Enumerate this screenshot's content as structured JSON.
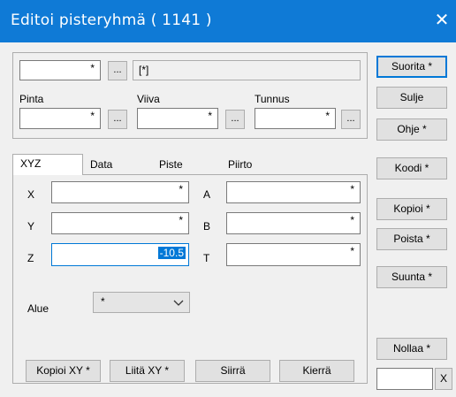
{
  "window": {
    "title": "Editoi pisteryhmä  ( 1141 )",
    "close_glyph": "✕"
  },
  "top": {
    "code_field": "*",
    "dots": "...",
    "description": "[*]",
    "pinta_label": "Pinta",
    "pinta_value": "*",
    "viiva_label": "Viiva",
    "viiva_value": "*",
    "tunnus_label": "Tunnus",
    "tunnus_value": "*"
  },
  "tabs": [
    {
      "label": "XYZ",
      "active": true
    },
    {
      "label": "Data"
    },
    {
      "label": "Piste"
    },
    {
      "label": "Piirto"
    }
  ],
  "xyz": {
    "x_label": "X",
    "x_value": "*",
    "y_label": "Y",
    "y_value": "*",
    "z_label": "Z",
    "z_value": "-10.5",
    "a_label": "A",
    "a_value": "*",
    "b_label": "B",
    "b_value": "*",
    "t_label": "T",
    "t_value": "*",
    "alue_label": "Alue",
    "alue_value": "*"
  },
  "bottom_buttons": {
    "kopioi_xy": "Kopioi XY *",
    "liita_xy": "Liitä XY *",
    "siirra": "Siirrä",
    "kierra": "Kierrä"
  },
  "side_buttons": {
    "suorita": "Suorita *",
    "sulje": "Sulje",
    "ohje": "Ohje *",
    "koodi": "Koodi *",
    "kopioi": "Kopioi *",
    "poista": "Poista *",
    "suunta": "Suunta *",
    "nollaa": "Nollaa *",
    "x_button": "X"
  },
  "colors": {
    "titlebar": "#0f7ad6",
    "selection": "#0078d7",
    "background": "#f0f0f0"
  }
}
